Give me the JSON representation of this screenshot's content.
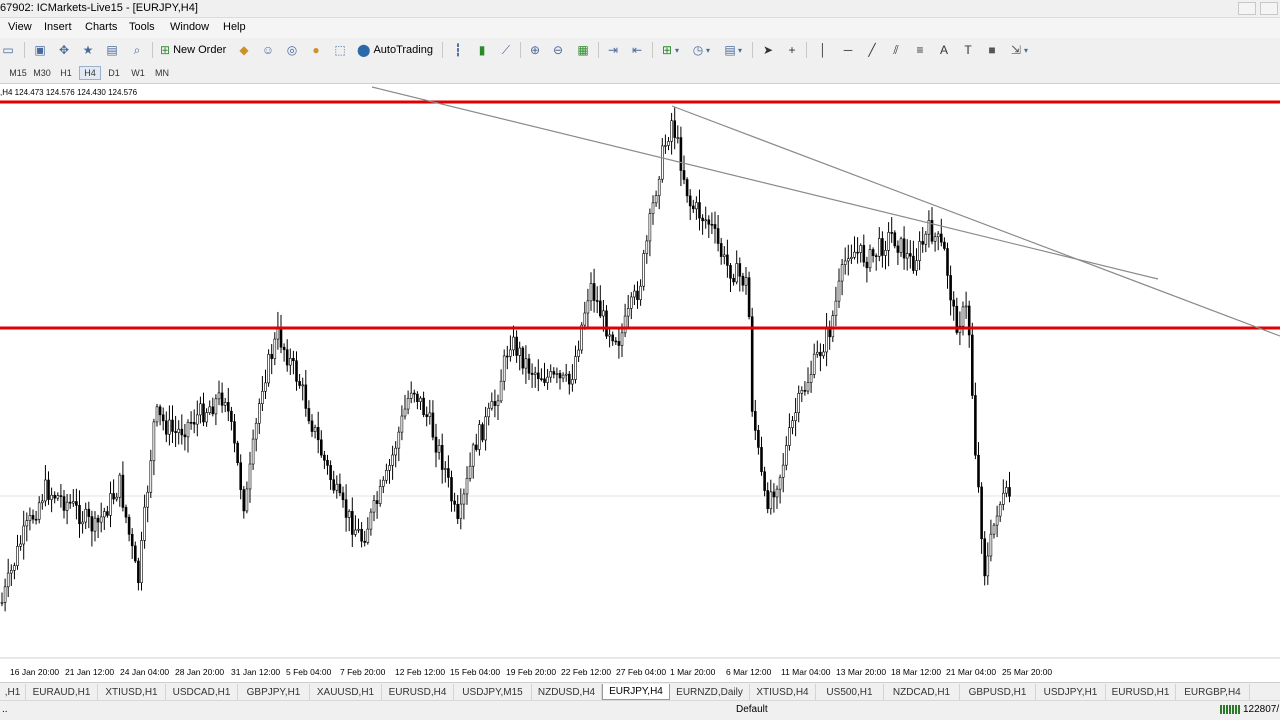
{
  "window": {
    "title": "67902: ICMarkets-Live15 - [EURJPY,H4]"
  },
  "menu": [
    "View",
    "Insert",
    "Charts",
    "Tools",
    "Window",
    "Help"
  ],
  "toolbar": {
    "new_order": "New Order",
    "auto_trading": "AutoTrading"
  },
  "timeframes": {
    "items": [
      "M15",
      "M30",
      "H1",
      "H4",
      "D1",
      "W1",
      "MN"
    ],
    "active": "H4"
  },
  "chart": {
    "info": ",H4  124.473 124.576 124.430 124.576",
    "time_labels": [
      "16 Jan 20:00",
      "21 Jan 12:00",
      "24 Jan 04:00",
      "28 Jan 20:00",
      "31 Jan 12:00",
      "5 Feb 04:00",
      "7 Feb 20:00",
      "12 Feb 12:00",
      "15 Feb 04:00",
      "19 Feb 20:00",
      "22 Feb 12:00",
      "27 Feb 04:00",
      "1 Mar 20:00",
      "6 Mar 12:00",
      "11 Mar 04:00",
      "13 Mar 20:00",
      "18 Mar 12:00",
      "21 Mar 04:00",
      "25 Mar 20:00"
    ],
    "colors": {
      "resistance": "#e00000",
      "trendline": "#8a8a8a",
      "candle": "#000000"
    }
  },
  "tabs": {
    "items": [
      ",H1",
      "EURAUD,H1",
      "XTIUSD,H1",
      "USDCAD,H1",
      "GBPJPY,H1",
      "XAUUSD,H1",
      "EURUSD,H4",
      "USDJPY,M15",
      "NZDUSD,H4",
      "EURJPY,H4",
      "EURNZD,Daily",
      "XTIUSD,H4",
      "US500,H1",
      "NZDCAD,H1",
      "GBPUSD,H1",
      "USDJPY,H1",
      "EURUSD,H1",
      "EURGBP,H4"
    ],
    "active": "EURJPY,H4"
  },
  "status": {
    "profile": "Default",
    "traffic": "122807/"
  }
}
